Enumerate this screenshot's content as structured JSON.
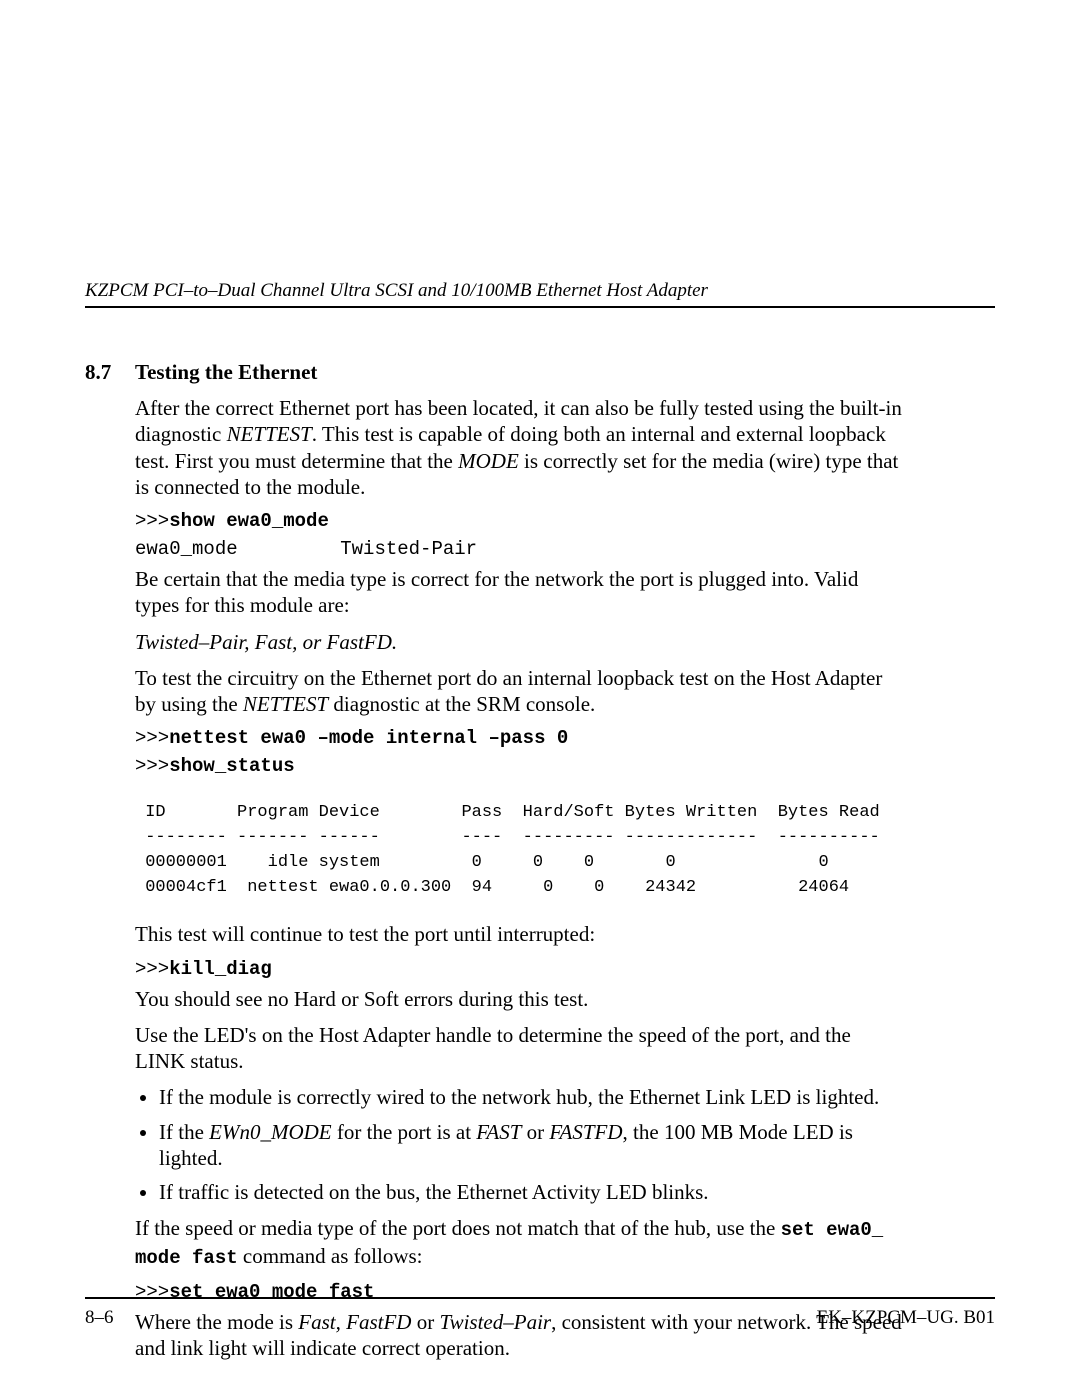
{
  "header": {
    "running_title": "KZPCM PCI–to–Dual Channel Ultra SCSI and 10/100MB Ethernet Host Adapter"
  },
  "section": {
    "number": "8.7",
    "title": "Testing the Ethernet"
  },
  "paragraphs": {
    "intro_a": "After the correct Ethernet port has been located, it can also be fully tested using the built-in diagnostic ",
    "intro_b": "NETTEST",
    "intro_c": ".  This test is capable of doing both an internal and external loopback test. First you must determine that the ",
    "intro_d": "MODE",
    "intro_e": " is correctly set for the media (wire) type that is connected to the module.",
    "cmd1_prompt": ">>>",
    "cmd1_cmd": "show ewa0_mode",
    "cmd1_out": "ewa0_mode         Twisted-Pair",
    "media_check": "Be certain that the media type is correct for the network the port is plugged into. Valid types for this module are:",
    "valid_types": "Twisted–Pair, Fast, or FastFD.",
    "test_a": "To test the circuitry on the Ethernet port do an internal loopback test on the Host Adapter by using the ",
    "test_b": "NETTEST",
    "test_c": " diagnostic at the SRM console.",
    "cmd2_prompt": ">>>",
    "cmd2_cmd": "nettest ewa0 –mode internal –pass 0",
    "cmd3_prompt": ">>>",
    "cmd3_cmd": "show_status",
    "table_hdr": " ID       Program Device        Pass  Hard/Soft Bytes Written  Bytes Read",
    "table_sep": " -------- ------- ------        ----  --------- -------------  ----------",
    "table_row1": " 00000001    idle system         0     0    0       0              0",
    "table_row2": " 00004cf1  nettest ewa0.0.0.300  94     0    0    24342          24064",
    "cont": "This test will continue to test the port until interrupted:",
    "cmd4_prompt": ">>>",
    "cmd4_cmd": "kill_diag",
    "no_errors": "You should see no Hard or Soft errors during this test.",
    "led_intro": "Use the LED's on the Host Adapter handle to determine the speed of the port, and the LINK status.",
    "li1": "If the module is correctly wired to the network hub, the Ethernet Link LED is lighted.",
    "li2_a": "If the ",
    "li2_b": "EWn0_MODE",
    "li2_c": " for the port is at ",
    "li2_d": "FAST",
    "li2_e": " or ",
    "li2_f": "FASTFD",
    "li2_g": ", the 100 MB Mode LED is lighted.",
    "li3": "If traffic is detected on the bus, the Ethernet Activity LED blinks.",
    "mismatch_a": "If the speed or media type of the port does not match that of the hub, use the ",
    "mismatch_cmd": "set ewa0_ mode fast",
    "mismatch_b": " command as follows:",
    "cmd5_prompt": ">>>",
    "cmd5_cmd": "set ewa0_mode fast",
    "where_a": "Where the mode is ",
    "where_b": "Fast, FastFD",
    "where_c": " or ",
    "where_d": "Twisted–Pair",
    "where_e": ", consistent with your network. The speed and link light will indicate correct operation."
  },
  "footer": {
    "left": "8–6",
    "right": "EK–KZPCM–UG. B01"
  }
}
